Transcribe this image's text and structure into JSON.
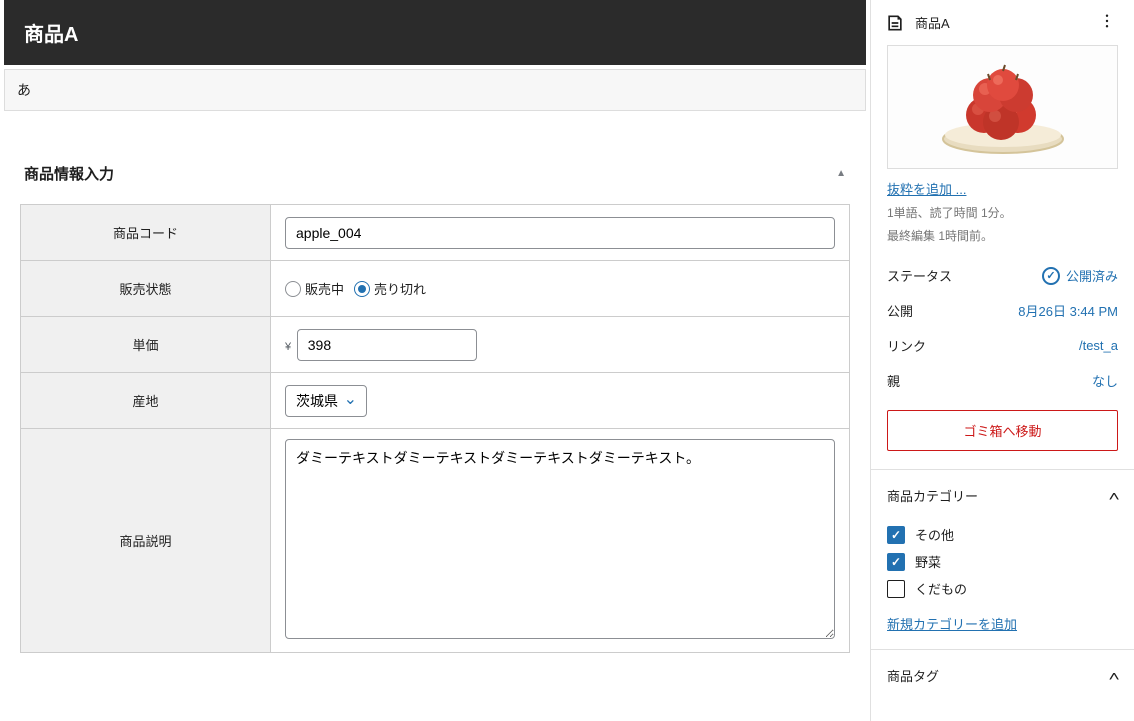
{
  "editor": {
    "title": "商品A",
    "content": "あ"
  },
  "productPanel": {
    "heading": "商品情報入力",
    "fields": {
      "codeLabel": "商品コード",
      "codeValue": "apple_004",
      "statusLabel": "販売状態",
      "statusOptions": {
        "onSale": "販売中",
        "soldOut": "売り切れ"
      },
      "statusSelected": "soldOut",
      "priceLabel": "単価",
      "priceCurrency": "¥",
      "priceValue": "398",
      "originLabel": "産地",
      "originValue": "茨城県",
      "descLabel": "商品説明",
      "descValue": "ダミーテキストダミーテキストダミーテキストダミーテキスト。"
    }
  },
  "sidebar": {
    "docTitle": "商品A",
    "excerptLink": "抜粋を追加",
    "readTime": "1単語、読了時間 1分。",
    "lastEdit": "最終編集 1時間前。",
    "kv": {
      "statusLabel": "ステータス",
      "statusValue": "公開済み",
      "publishLabel": "公開",
      "publishValue": "8月26日 3:44 PM",
      "linkLabel": "リンク",
      "linkValue": "/test_a",
      "parentLabel": "親",
      "parentValue": "なし"
    },
    "trash": "ゴミ箱へ移動",
    "catHeading": "商品カテゴリー",
    "categories": [
      {
        "label": "その他",
        "checked": true
      },
      {
        "label": "野菜",
        "checked": true
      },
      {
        "label": "くだもの",
        "checked": false
      }
    ],
    "addCategory": "新規カテゴリーを追加",
    "tagHeading": "商品タグ"
  }
}
